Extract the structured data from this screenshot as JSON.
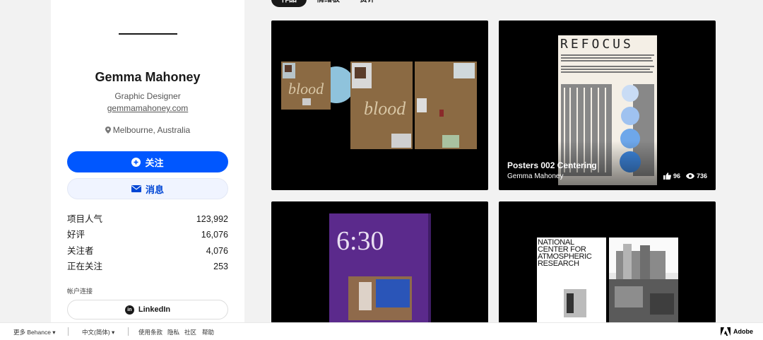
{
  "profile": {
    "name": "Gemma Mahoney",
    "role": "Graphic Designer",
    "website": "gemmamahoney.com",
    "location": "Melbourne, Australia",
    "follow_label": "关注",
    "message_label": "消息"
  },
  "stats": [
    {
      "label": "项目人气",
      "value": "123,992"
    },
    {
      "label": "好评",
      "value": "16,076"
    },
    {
      "label": "关注者",
      "value": "4,076"
    },
    {
      "label": "正在关注",
      "value": "253"
    }
  ],
  "accounts": {
    "label": "帐户连接",
    "linkedin_label": "LinkedIn"
  },
  "tabs": [
    {
      "label": "作品",
      "active": true
    },
    {
      "label": "情绪板",
      "active": false
    },
    {
      "label": "赞评",
      "active": false
    }
  ],
  "projects": [
    {
      "id": "blood",
      "cover_text": [
        "blood",
        "blood"
      ]
    },
    {
      "id": "refocus",
      "cover_text": [
        "REFOCUS"
      ],
      "title": "Posters 002 Centering",
      "owner": "Gemma Mahoney",
      "appreciations": "96",
      "views": "736"
    },
    {
      "id": "six-thirty",
      "cover_text": [
        "6:30"
      ]
    },
    {
      "id": "ncar",
      "cover_text": [
        "NATIONAL CENTER FOR ATMOSPHERIC RESEARCH"
      ]
    }
  ],
  "footer": {
    "more_behance": "更多 Behance",
    "language": "中文(简体)",
    "terms": "使用条款",
    "privacy": "隐私",
    "community": "社区",
    "help": "帮助",
    "adobe": "Adobe"
  },
  "colors": {
    "accent_blue": "#0057ff",
    "message_bg": "#f0f4ff",
    "card_bg": "#000000"
  }
}
